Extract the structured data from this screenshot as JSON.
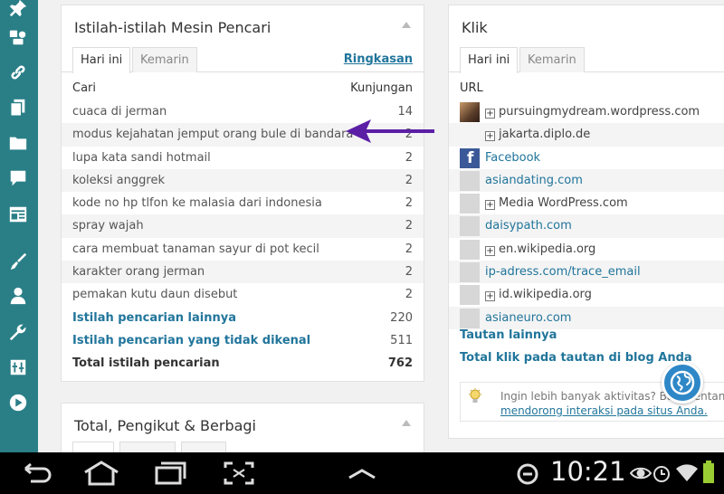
{
  "search_panel": {
    "title": "Istilah-istilah Mesin Pencari",
    "tabs": [
      "Hari ini",
      "Kemarin"
    ],
    "summary_link": "Ringkasan",
    "col_left": "Cari",
    "col_right": "Kunjungan",
    "rows": [
      {
        "term": "cuaca di jerman",
        "count": "14"
      },
      {
        "term": "modus kejahatan jemput orang bule di bandara",
        "count": "2"
      },
      {
        "term": "lupa kata sandi hotmail",
        "count": "2"
      },
      {
        "term": "koleksi anggrek",
        "count": "2"
      },
      {
        "term": "kode no hp tlfon ke malasia dari indonesia",
        "count": "2"
      },
      {
        "term": "spray wajah",
        "count": "2"
      },
      {
        "term": "cara membuat tanaman sayur di pot kecil",
        "count": "2"
      },
      {
        "term": "karakter orang jerman",
        "count": "2"
      },
      {
        "term": "pemakan kutu daun disebut",
        "count": "2"
      }
    ],
    "more_label": "Istilah pencarian lainnya",
    "more_count": "220",
    "unknown_label": "Istilah pencarian yang tidak dikenal",
    "unknown_count": "511",
    "total_label": "Total istilah pencarian",
    "total_count": "762"
  },
  "followers_panel": {
    "title": "Total, Pengikut & Berbagi"
  },
  "klik_panel": {
    "title": "Klik",
    "tabs": [
      "Hari ini",
      "Kemarin"
    ],
    "col": "URL",
    "rows": [
      {
        "text": "pursuingmydream.wordpress.com",
        "expand": true,
        "link": false,
        "thumb": "avatar"
      },
      {
        "text": "jakarta.diplo.de",
        "expand": true,
        "link": false,
        "thumb": "none"
      },
      {
        "text": "Facebook",
        "expand": false,
        "link": true,
        "thumb": "fb"
      },
      {
        "text": "asiandating.com",
        "expand": false,
        "link": true,
        "thumb": "blank"
      },
      {
        "text": "Media WordPress.com",
        "expand": true,
        "link": false,
        "thumb": "blank"
      },
      {
        "text": "daisypath.com",
        "expand": false,
        "link": true,
        "thumb": "blank"
      },
      {
        "text": "en.wikipedia.org",
        "expand": true,
        "link": false,
        "thumb": "blank"
      },
      {
        "text": "ip-adress.com/trace_email",
        "expand": false,
        "link": true,
        "thumb": "blank"
      },
      {
        "text": "id.wikipedia.org",
        "expand": true,
        "link": false,
        "thumb": "blank"
      },
      {
        "text": "asianeuro.com",
        "expand": false,
        "link": true,
        "thumb": "blank"
      }
    ],
    "more_label": "Tautan lainnya",
    "total_label": "Total klik pada tautan di blog Anda",
    "tip_text": "Ingin lebih banyak aktivitas? Baca tentang",
    "tip_link": "mendorong interaksi pada situs Anda."
  },
  "status_bar": {
    "time": "10:21"
  },
  "colors": {
    "sidebar": "#2a7f87",
    "link": "#21759b",
    "arrow": "#5b1fa6"
  }
}
